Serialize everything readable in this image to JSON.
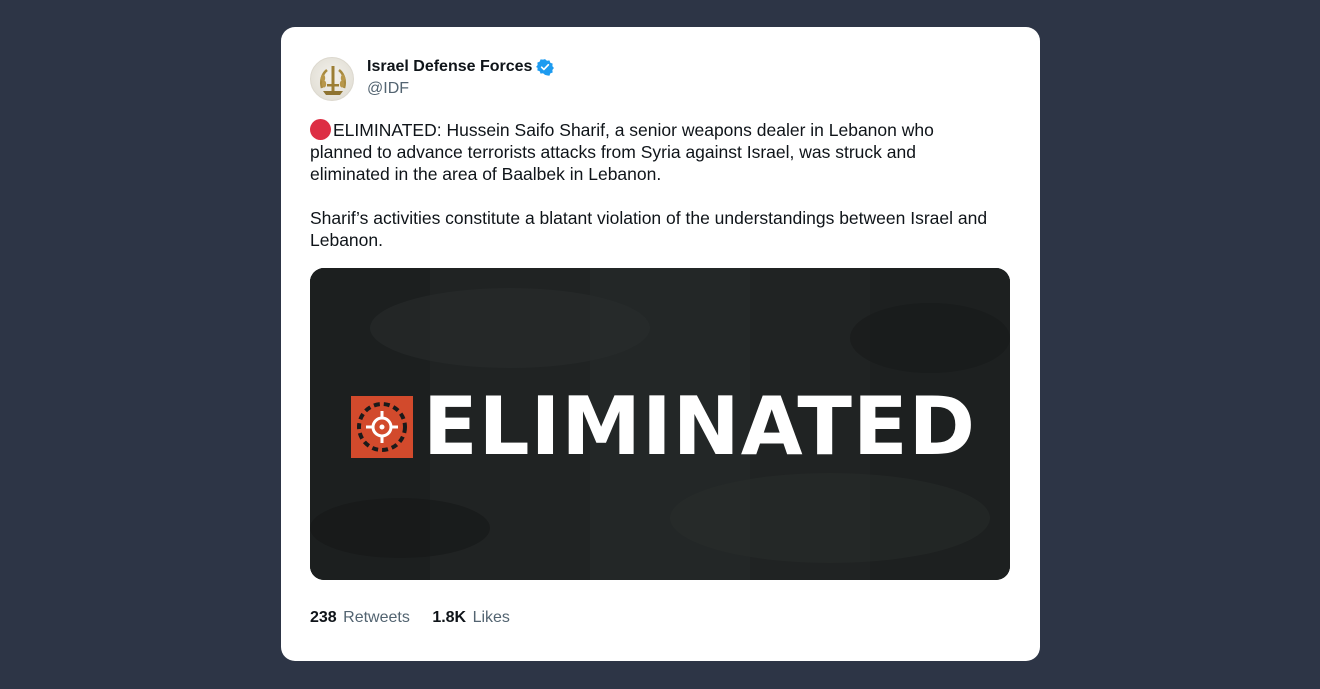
{
  "author": {
    "display_name": "Israel Defense Forces",
    "handle": "@IDF",
    "verified": true,
    "avatar_icon": "idf-emblem-icon"
  },
  "tweet": {
    "paragraphs": [
      "ELIMINATED: Hussein Saifo Sharif, a senior weapons dealer in Lebanon who planned to advance terrorists attacks from Syria against Israel, was struck and eliminated in the area of Baalbek in Lebanon.",
      "Sharif’s activities constitute a blatant violation of the understandings between Israel and Lebanon."
    ],
    "leading_emoji": "red-circle-icon"
  },
  "media": {
    "banner_text": "ELIMINATED",
    "icon": "crosshair-target-icon",
    "colors": {
      "background": "#1f2222",
      "accent": "#d24a2c",
      "text": "#ffffff"
    }
  },
  "stats": {
    "retweets_count": "238",
    "retweets_label": "Retweets",
    "likes_count": "1.8K",
    "likes_label": "Likes"
  },
  "colors": {
    "page_background": "#2d3546",
    "card_background": "#ffffff",
    "verified_badge": "#1d9bf0",
    "secondary_text": "#536471"
  }
}
